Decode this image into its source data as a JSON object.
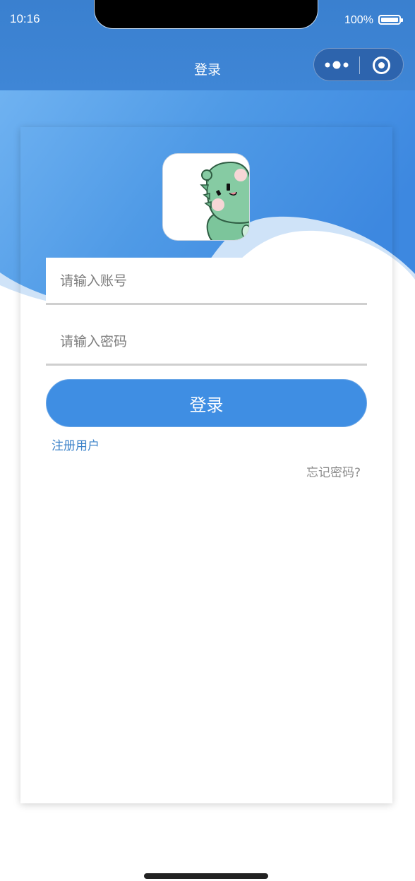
{
  "status_bar": {
    "time": "10:16",
    "battery_percent": "100%"
  },
  "nav": {
    "title": "登录"
  },
  "capsule": {
    "more_icon": "more-dots-icon",
    "close_icon": "target-circle-icon"
  },
  "form": {
    "account_placeholder": "请输入账号",
    "password_placeholder": "请输入密码",
    "login_label": "登录",
    "register_label": "注册用户",
    "forgot_label": "忘记密码?"
  },
  "colors": {
    "nav_bar": "#3a80cf",
    "banner_blue": "#4a95e3",
    "button": "#3f8ee3",
    "link": "#3b82c9"
  }
}
